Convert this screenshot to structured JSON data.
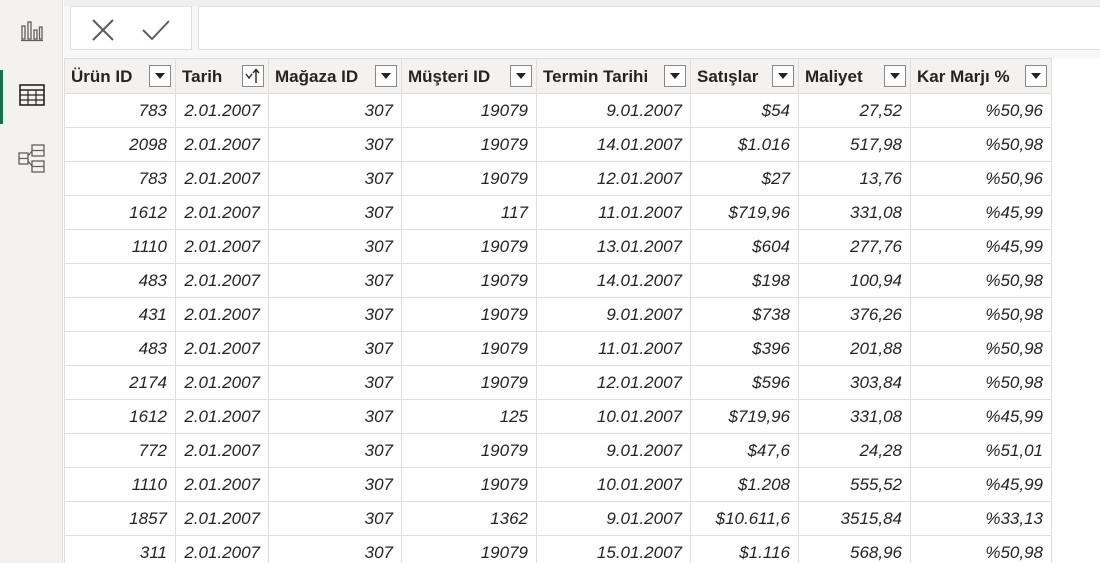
{
  "rail": {
    "items": [
      {
        "name": "report-view-icon",
        "active": false
      },
      {
        "name": "data-view-icon",
        "active": true
      },
      {
        "name": "model-view-icon",
        "active": false
      }
    ]
  },
  "formula_bar": {
    "cancel_icon": "close-icon",
    "commit_icon": "check-icon",
    "value": ""
  },
  "table": {
    "columns": [
      {
        "label": "Ürün ID",
        "filter": "dropdown"
      },
      {
        "label": "Tarih",
        "filter": "sort-ascending"
      },
      {
        "label": "Mağaza ID",
        "filter": "dropdown"
      },
      {
        "label": "Müşteri ID",
        "filter": "dropdown"
      },
      {
        "label": "Termin Tarihi",
        "filter": "dropdown"
      },
      {
        "label": "Satışlar",
        "filter": "dropdown"
      },
      {
        "label": "Maliyet",
        "filter": "dropdown"
      },
      {
        "label": "Kar Marjı %",
        "filter": "dropdown"
      }
    ],
    "rows": [
      [
        "783",
        "2.01.2007",
        "307",
        "19079",
        "9.01.2007",
        "$54",
        "27,52",
        "%50,96"
      ],
      [
        "2098",
        "2.01.2007",
        "307",
        "19079",
        "14.01.2007",
        "$1.016",
        "517,98",
        "%50,98"
      ],
      [
        "783",
        "2.01.2007",
        "307",
        "19079",
        "12.01.2007",
        "$27",
        "13,76",
        "%50,96"
      ],
      [
        "1612",
        "2.01.2007",
        "307",
        "117",
        "11.01.2007",
        "$719,96",
        "331,08",
        "%45,99"
      ],
      [
        "1110",
        "2.01.2007",
        "307",
        "19079",
        "13.01.2007",
        "$604",
        "277,76",
        "%45,99"
      ],
      [
        "483",
        "2.01.2007",
        "307",
        "19079",
        "14.01.2007",
        "$198",
        "100,94",
        "%50,98"
      ],
      [
        "431",
        "2.01.2007",
        "307",
        "19079",
        "9.01.2007",
        "$738",
        "376,26",
        "%50,98"
      ],
      [
        "483",
        "2.01.2007",
        "307",
        "19079",
        "11.01.2007",
        "$396",
        "201,88",
        "%50,98"
      ],
      [
        "2174",
        "2.01.2007",
        "307",
        "19079",
        "12.01.2007",
        "$596",
        "303,84",
        "%50,98"
      ],
      [
        "1612",
        "2.01.2007",
        "307",
        "125",
        "10.01.2007",
        "$719,96",
        "331,08",
        "%45,99"
      ],
      [
        "772",
        "2.01.2007",
        "307",
        "19079",
        "9.01.2007",
        "$47,6",
        "24,28",
        "%51,01"
      ],
      [
        "1110",
        "2.01.2007",
        "307",
        "19079",
        "10.01.2007",
        "$1.208",
        "555,52",
        "%45,99"
      ],
      [
        "1857",
        "2.01.2007",
        "307",
        "1362",
        "9.01.2007",
        "$10.611,6",
        "3515,84",
        "%33,13"
      ],
      [
        "311",
        "2.01.2007",
        "307",
        "19079",
        "15.01.2007",
        "$1.116",
        "568,96",
        "%50,98"
      ]
    ]
  }
}
